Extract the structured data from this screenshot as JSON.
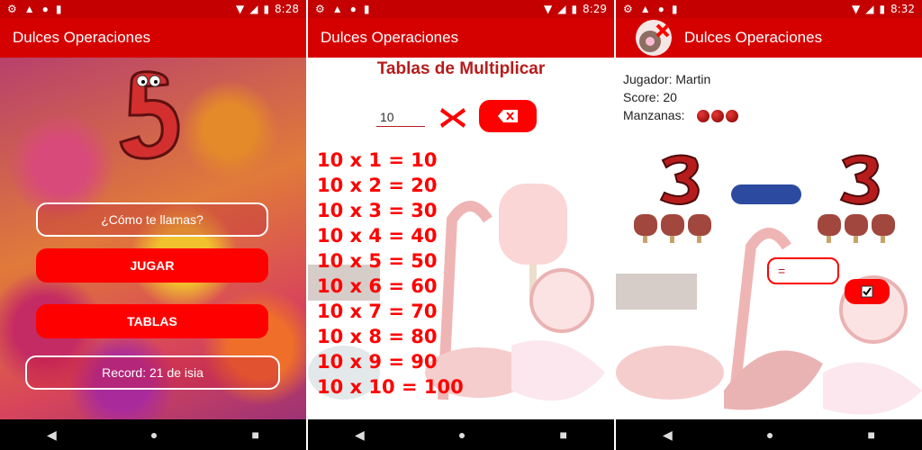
{
  "status": [
    {
      "time": "8:28"
    },
    {
      "time": "8:29"
    },
    {
      "time": "8:32"
    }
  ],
  "app_title": "Dulces Operaciones",
  "screen1": {
    "name_placeholder": "¿Cómo te llamas?",
    "play_label": "JUGAR",
    "tables_label": "TABLAS",
    "record_text": "Record: 21 de isia"
  },
  "screen2": {
    "title": "Tablas de Multiplicar",
    "input_value": "10",
    "rows": [
      [
        "10",
        "x",
        "1",
        "=",
        "10"
      ],
      [
        "10",
        "x",
        "2",
        "=",
        "20"
      ],
      [
        "10",
        "x",
        "3",
        "=",
        "30"
      ],
      [
        "10",
        "x",
        "4",
        "=",
        "40"
      ],
      [
        "10",
        "x",
        "5",
        "=",
        "50"
      ],
      [
        "10",
        "x",
        "6",
        "=",
        "60"
      ],
      [
        "10",
        "x",
        "7",
        "=",
        "70"
      ],
      [
        "10",
        "x",
        "8",
        "=",
        "80"
      ],
      [
        "10",
        "x",
        "9",
        "=",
        "90"
      ],
      [
        "10",
        "x",
        "10",
        "=",
        "100"
      ]
    ]
  },
  "screen3": {
    "player_label": "Jugador: Martin",
    "score_label": "Score: 20",
    "apples_label": "Manzanas:",
    "apples_count": 3,
    "answer_value": "="
  },
  "colors": {
    "status": "#c40000",
    "appbar": "#d50000",
    "accent": "#ff0000",
    "blue": "#2b4aa0"
  }
}
